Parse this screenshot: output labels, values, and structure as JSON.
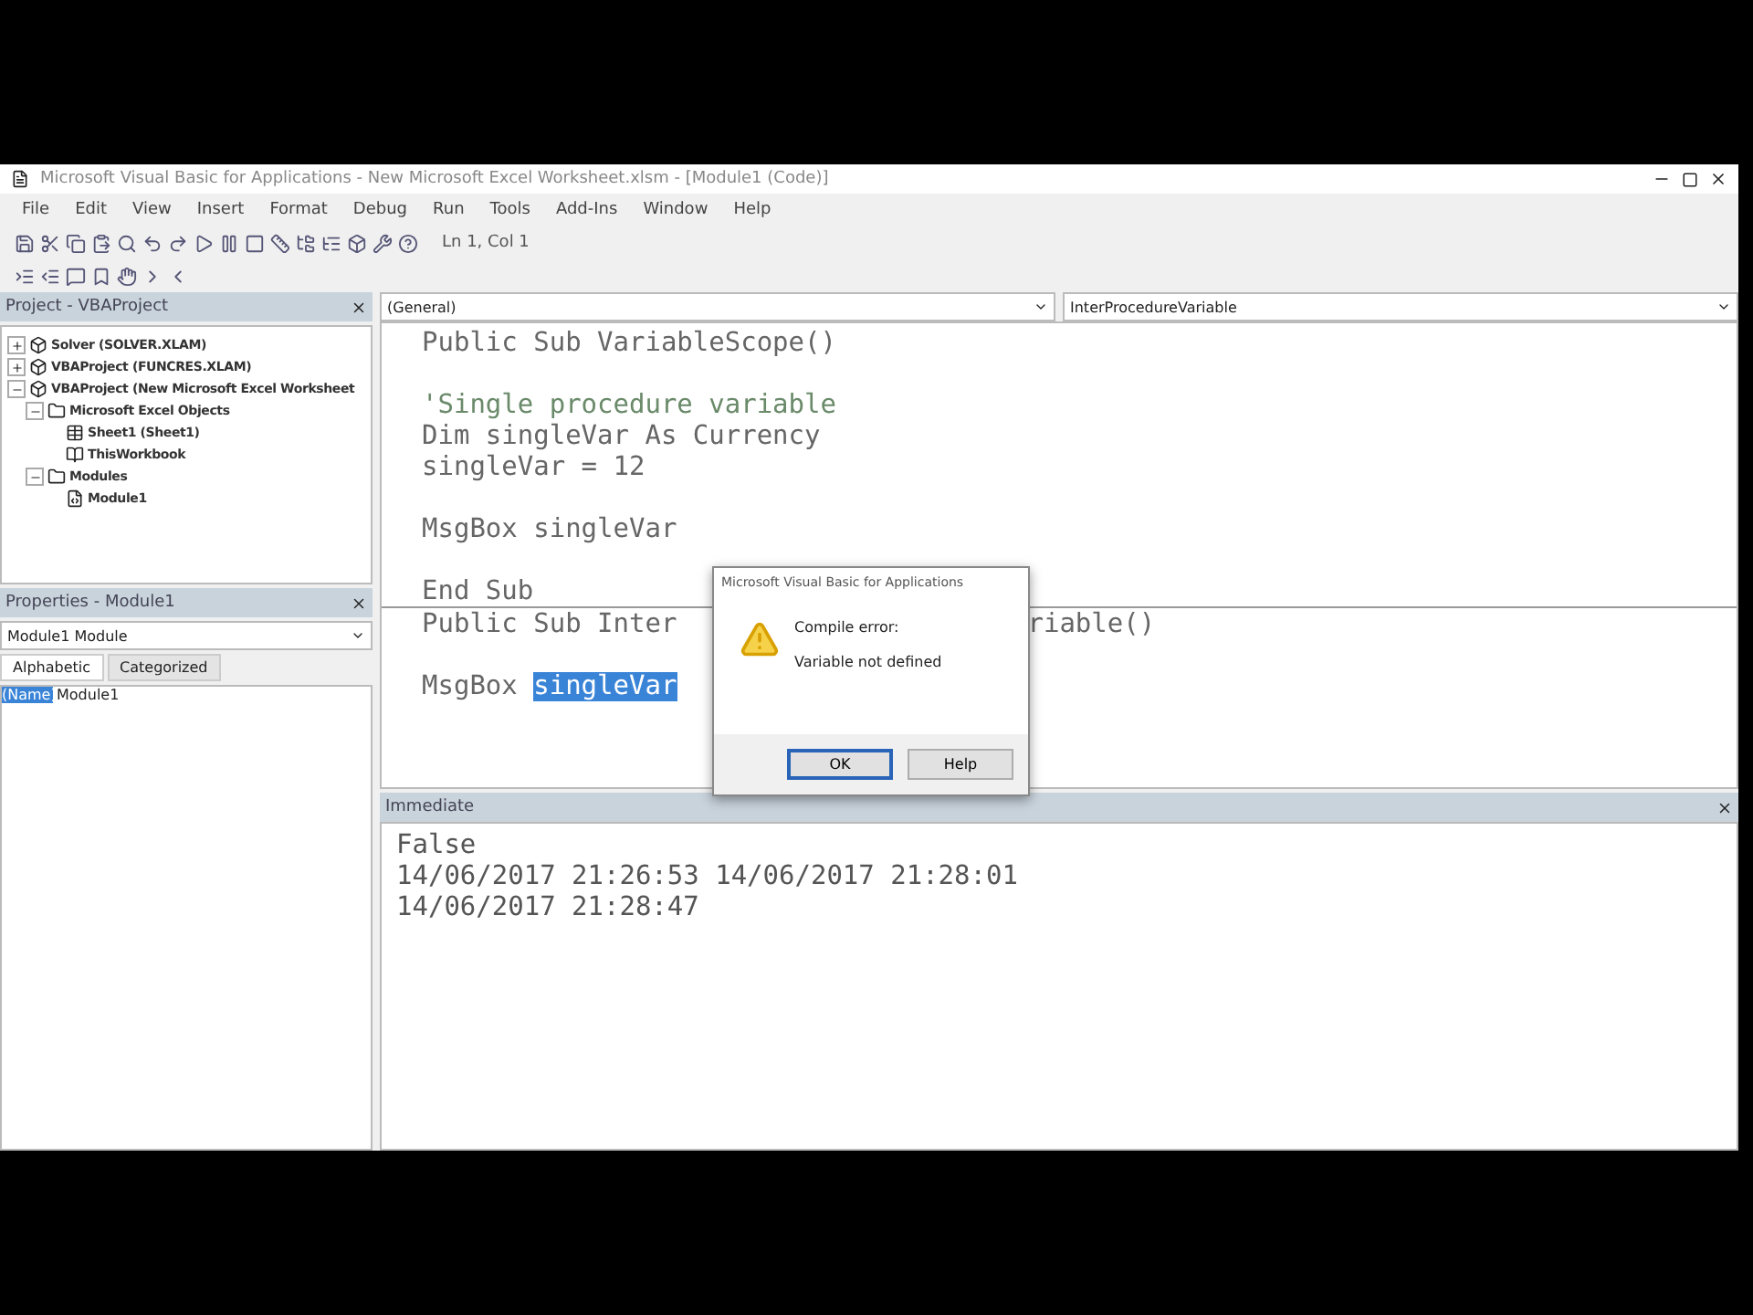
{
  "window": {
    "title": "Microsoft Visual Basic for Applications - New Microsoft Excel Worksheet.xlsm - [Module1 (Code)]"
  },
  "menu": [
    "File",
    "Edit",
    "View",
    "Insert",
    "Format",
    "Debug",
    "Run",
    "Tools",
    "Add-Ins",
    "Window",
    "Help"
  ],
  "toolbar": {
    "position": "Ln 1, Col 1"
  },
  "project": {
    "title": "Project - VBAProject",
    "tree": [
      {
        "label": "Solver (SOLVER.XLAM)",
        "kind": "project",
        "expanded": false
      },
      {
        "label": "VBAProject (FUNCRES.XLAM)",
        "kind": "project",
        "expanded": false
      },
      {
        "label": "VBAProject (New Microsoft Excel Worksheet",
        "kind": "project",
        "expanded": true,
        "children": [
          {
            "label": "Microsoft Excel Objects",
            "kind": "folder",
            "expanded": true,
            "children": [
              {
                "label": "Sheet1 (Sheet1)",
                "kind": "sheet"
              },
              {
                "label": "ThisWorkbook",
                "kind": "book"
              }
            ]
          },
          {
            "label": "Modules",
            "kind": "folder",
            "expanded": true,
            "children": [
              {
                "label": "Module1",
                "kind": "module"
              }
            ]
          }
        ]
      }
    ]
  },
  "properties": {
    "title": "Properties - Module1",
    "object": "Module1 Module",
    "tabs": [
      {
        "label": "Alphabetic",
        "selected": true
      },
      {
        "label": "Categorized",
        "selected": false
      }
    ],
    "rows": [
      {
        "name": "(Name)",
        "value": "Module1",
        "selected": true
      }
    ]
  },
  "code": {
    "object": "(General)",
    "procedure": "InterProcedureVariable",
    "lines": [
      {
        "kind": "code",
        "parts": [
          {
            "text": "Public Sub VariableScope()",
            "selected": false
          }
        ]
      },
      {
        "kind": "blank"
      },
      {
        "kind": "comment",
        "parts": [
          {
            "text": "'Single procedure variable",
            "selected": false
          }
        ]
      },
      {
        "kind": "code",
        "parts": [
          {
            "text": "Dim singleVar As Currency",
            "selected": false
          }
        ]
      },
      {
        "kind": "code",
        "parts": [
          {
            "text": "singleVar = 12",
            "selected": false
          }
        ]
      },
      {
        "kind": "blank"
      },
      {
        "kind": "code",
        "parts": [
          {
            "text": "MsgBox singleVar",
            "selected": false
          }
        ]
      },
      {
        "kind": "blank"
      },
      {
        "kind": "code",
        "parts": [
          {
            "text": "End Sub",
            "selected": false
          }
        ]
      },
      {
        "kind": "separator"
      },
      {
        "kind": "code",
        "parts": [
          {
            "text": "Public Sub Inter",
            "selected": false
          },
          {
            "text": "riable()",
            "selected": false,
            "kind": "after_gap"
          }
        ]
      },
      {
        "kind": "blank"
      },
      {
        "kind": "code",
        "parts": [
          {
            "text": "MsgBox ",
            "selected": false
          },
          {
            "text": "singleVar",
            "selected": true
          }
        ]
      }
    ]
  },
  "dialog": {
    "title": "Microsoft Visual Basic for Applications",
    "heading": "Compile error:",
    "message": "Variable not defined",
    "buttons": [
      {
        "label": "OK",
        "selected": true
      },
      {
        "label": "Help",
        "selected": false
      }
    ]
  },
  "immediate": {
    "title": "Immediate",
    "lines": [
      "False",
      "14/06/2017 21:26:53 14/06/2017 21:28:01",
      "14/06/2017 21:28:47"
    ]
  }
}
